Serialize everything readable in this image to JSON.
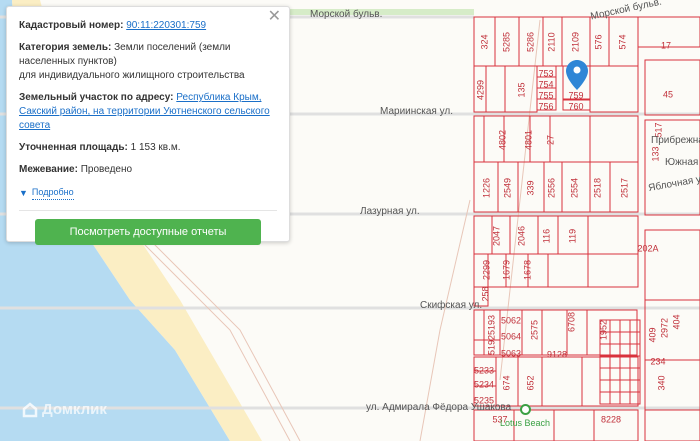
{
  "popup": {
    "cadastral_label": "Кадастровый номер:",
    "cadastral_value": "90:11:220301:759",
    "category_label": "Категория земель:",
    "category_value": "Земли поселений (земли населенных пунктов)",
    "category_use": "для индивидуального жилищного строительства",
    "address_label": "Земельный участок по адресу:",
    "address_value": "Республика Крым, Сакский район, на территории Уютненского сельского совета",
    "area_label": "Уточненная площадь:",
    "area_value": "1 153 кв.м.",
    "survey_label": "Межевание:",
    "survey_value": "Проведено",
    "more_link": "Подробно",
    "reports_button": "Посмотреть доступные отчеты",
    "close": "✕"
  },
  "streets": [
    "Морской бульв.",
    "Мариинская ул.",
    "Лазурная ул.",
    "Скифская ул.",
    "ул. Адмирала Фёдора Ушакова",
    "Морской бульв.",
    "Прибрежная",
    "Южная ул",
    "Яблочная ул"
  ],
  "parcel_labels": [
    "324",
    "5285",
    "5286",
    "2110",
    "2109",
    "576",
    "574",
    "4299",
    "135",
    "753",
    "754",
    "755",
    "756",
    "759",
    "760",
    "4802",
    "4801",
    "27",
    "1226",
    "2549",
    "339",
    "2556",
    "2554",
    "2518",
    "2517",
    "2047",
    "2046",
    "116",
    "119",
    "2299",
    "1679",
    "1678",
    "258",
    "5193",
    "5062",
    "5064",
    "5063",
    "5192",
    "2575",
    "9128",
    "6708",
    "1952",
    "5233",
    "5234",
    "5235",
    "674",
    "652",
    "537",
    "8228",
    "133",
    "409",
    "2972",
    "404",
    "234",
    "340",
    "17",
    "45",
    "517",
    "202А"
  ],
  "poi": "Lotus Beach",
  "watermark": "Домклик",
  "colors": {
    "parcel": "#d9323c",
    "sea": "#b5dbf2",
    "beach": "#fbeec4",
    "button": "#4fb34f",
    "link": "#1a6fc8",
    "pin": "#2f86d6"
  }
}
